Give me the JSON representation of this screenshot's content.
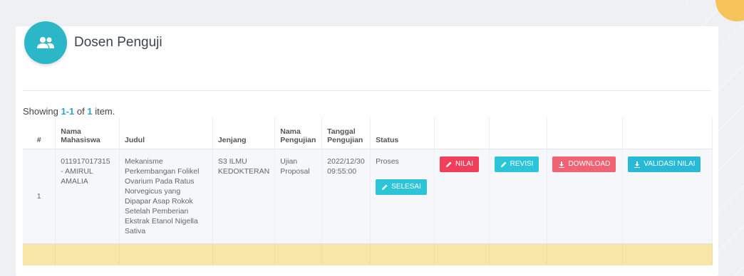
{
  "page": {
    "title": "Dosen Penguji",
    "header_icon": "users-icon"
  },
  "summary": {
    "prefix": "Showing ",
    "range": "1-1",
    "of": " of ",
    "total": "1",
    "suffix": " item."
  },
  "table": {
    "headers": {
      "num": "#",
      "nama_mahasiswa": "Nama Mahasiswa",
      "judul": "Judul",
      "jenjang": "Jenjang",
      "nama_pengujian": "Nama Pengujian",
      "tanggal_pengujian": "Tanggal Pengujian",
      "status": "Status"
    },
    "rows": [
      {
        "num": "1",
        "nama_mahasiswa": "011917017315 - AMIRUL AMALIA",
        "judul": "Mekanisme Perkembangan Folikel Ovarium Pada Ratus Norvegicus yang Dipapar Asap Rokok Setelah Pemberian Ekstrak Etanol Nigella Sativa",
        "jenjang": "S3 ILMU KEDOKTERAN",
        "nama_pengujian": "Ujian Proposal",
        "tanggal_pengujian": "2022/12/30 09:55:00",
        "status": "Proses",
        "buttons": {
          "selesai": "SELESAI",
          "nilai": "NILAI",
          "revisi": "REVISI",
          "download": "DOWNLOAD",
          "validasi": "VALIDASI NILAI"
        }
      }
    ]
  },
  "colors": {
    "accent": "#2cb7c9",
    "nilai": "#f03e5b",
    "revisi": "#2cc5d8",
    "download": "#f16372",
    "validasi": "#27b9d6",
    "filter_row": "#f8e5a8"
  },
  "icons": {
    "pencil": "pencil-icon",
    "download": "download-icon"
  }
}
